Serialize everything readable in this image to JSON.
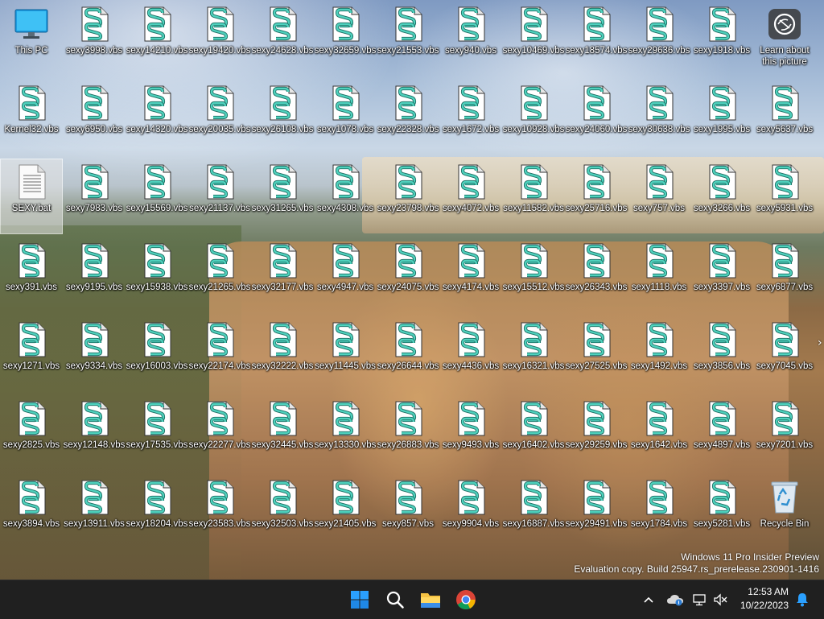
{
  "desktop": {
    "rows": [
      [
        "This PC",
        "sexy3998.vbs",
        "sexy14210.vbs",
        "sexy19420.vbs",
        "sexy24628.vbs",
        "sexy32659.vbs",
        "sexy21553.vbs",
        "sexy940.vbs",
        "sexy10469.vbs",
        "sexy18574.vbs",
        "sexy29636.vbs",
        "sexy1918.vbs",
        "Learn about this picture"
      ],
      [
        "Kernel32.vbs",
        "sexy6950.vbs",
        "sexy14320.vbs",
        "sexy20035.vbs",
        "sexy26108.vbs",
        "sexy1078.vbs",
        "sexy22328.vbs",
        "sexy1672.vbs",
        "sexy10928.vbs",
        "sexy24060.vbs",
        "sexy30638.vbs",
        "sexy1995.vbs",
        "sexy5637.vbs"
      ],
      [
        "SEXY.bat",
        "sexy7983.vbs",
        "sexy15569.vbs",
        "sexy21137.vbs",
        "sexy31265.vbs",
        "sexy4308.vbs",
        "sexy23798.vbs",
        "sexy4072.vbs",
        "sexy11582.vbs",
        "sexy25716.vbs",
        "sexy757.vbs",
        "sexy3266.vbs",
        "sexy5931.vbs"
      ],
      [
        "sexy391.vbs",
        "sexy9195.vbs",
        "sexy15938.vbs",
        "sexy21265.vbs",
        "sexy32177.vbs",
        "sexy4947.vbs",
        "sexy24075.vbs",
        "sexy4174.vbs",
        "sexy15512.vbs",
        "sexy26343.vbs",
        "sexy1118.vbs",
        "sexy3397.vbs",
        "sexy6877.vbs"
      ],
      [
        "sexy1271.vbs",
        "sexy9334.vbs",
        "sexy16003.vbs",
        "sexy22174.vbs",
        "sexy32222.vbs",
        "sexy11445.vbs",
        "sexy26644.vbs",
        "sexy4436.vbs",
        "sexy16321.vbs",
        "sexy27525.vbs",
        "sexy1492.vbs",
        "sexy3856.vbs",
        "sexy7045.vbs"
      ],
      [
        "sexy2825.vbs",
        "sexy12148.vbs",
        "sexy17535.vbs",
        "sexy22277.vbs",
        "sexy32445.vbs",
        "sexy13330.vbs",
        "sexy26883.vbs",
        "sexy9493.vbs",
        "sexy16402.vbs",
        "sexy29259.vbs",
        "sexy1642.vbs",
        "sexy4897.vbs",
        "sexy7201.vbs"
      ],
      [
        "sexy3894.vbs",
        "sexy13911.vbs",
        "sexy18204.vbs",
        "sexy23583.vbs",
        "sexy32503.vbs",
        "sexy21405.vbs",
        "sexy857.vbs",
        "sexy9904.vbs",
        "sexy16887.vbs",
        "sexy29491.vbs",
        "sexy1784.vbs",
        "sexy5281.vbs",
        "Recycle Bin"
      ]
    ],
    "icon_types": {
      "This PC": "monitor-icon",
      "Learn about this picture": "camera-info-icon",
      "SEXY.bat": "batch-file-icon",
      "Recycle Bin": "recycle-bin-icon",
      "default": "vbscript-file-icon"
    },
    "selected_item": "SEXY.bat"
  },
  "watermark": {
    "line1": "Windows 11 Pro Insider Preview",
    "line2": "Evaluation copy. Build 25947.rs_prerelease.230901-1416"
  },
  "taskbar": {
    "apps": [
      "start-icon",
      "search-icon",
      "file-explorer-icon",
      "chrome-icon"
    ],
    "tray_icons": [
      "chevron-up-icon",
      "onedrive-icon",
      "network-icon",
      "volume-muted-icon"
    ],
    "time": "12:53 AM",
    "date": "10/22/2023"
  },
  "colors": {
    "taskbar_bg": "#202020",
    "start_blue": "#0a6fd8",
    "vbs_teal": "#37b8a8"
  }
}
